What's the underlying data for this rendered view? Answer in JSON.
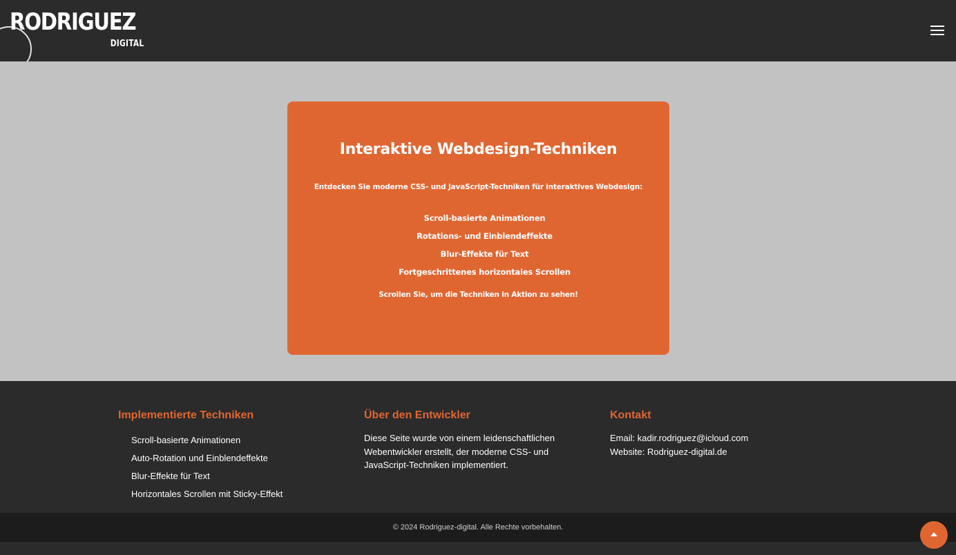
{
  "header": {
    "logo_main": "RODRIGUEZ",
    "logo_sub": "DIGITAL",
    "menu_icon": "hamburger-menu-icon"
  },
  "hero": {
    "title": "Interaktive Webdesign-Techniken",
    "subtitle": "Entdecken Sie moderne CSS- und JavaScript-Techniken für interaktives Webdesign:",
    "items": [
      "Scroll-basierte Animationen",
      "Rotations- und Einblendeffekte",
      "Blur-Effekte für Text",
      "Fortgeschrittenes horizontales Scrollen"
    ],
    "cta": "Scrollen Sie, um die Techniken in Aktion zu sehen!"
  },
  "footer": {
    "techniques": {
      "heading": "Implementierte Techniken",
      "items": [
        "Scroll-basierte Animationen",
        "Auto-Rotation und Einblendeffekte",
        "Blur-Effekte für Text",
        "Horizontales Scrollen mit Sticky-Effekt"
      ]
    },
    "about": {
      "heading": "Über den Entwickler",
      "text": "Diese Seite wurde von einem leidenschaftlichen Webentwickler erstellt, der moderne CSS- und JavaScript-Techniken implementiert."
    },
    "contact": {
      "heading": "Kontakt",
      "email_label": "Email: ",
      "email": "kadir.rodriguez@icloud.com",
      "website_label": "Website: ",
      "website": "Rodriguez-digital.de"
    },
    "copyright": "© 2024 Rodriguez-digital. Alle Rechte vorbehalten."
  },
  "to_top_icon": "arrow-up-icon",
  "colors": {
    "accent": "#e06631",
    "header_bg": "#2b2b2b",
    "hero_bg": "#c2c2c2",
    "copyright_bg": "#1c1c1c"
  }
}
